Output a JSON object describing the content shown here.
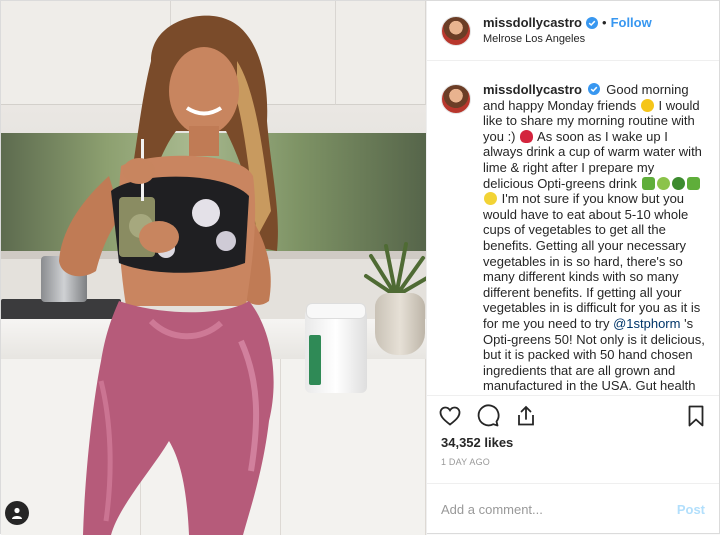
{
  "header": {
    "username": "missdollycastro",
    "separator": "•",
    "follow_label": "Follow",
    "location": "Melrose Los Angeles"
  },
  "caption": {
    "username": "missdollycastro",
    "t1": "Good morning and happy Monday friends",
    "t2": "I would like to share my morning routine with you :)",
    "t3": "As soon as I wake up I always drink a cup of warm water with lime & right after I prepare my delicious Opti-greens drink",
    "t4": "I'm not sure if you know but you would have to eat about 5-10 whole cups of vegetables to get all the benefits. Getting all your necessary vegetables in is so hard, there's so many different kinds with so many different benefits. If getting all your vegetables in is difficult for you as it is for me you need to try",
    "mention": "@1stphorm",
    "t5": "'s Opti-greens 50! Not only is it delicious, but it is packed with 50 hand chosen ingredients that are all grown and manufactured in the USA. Gut health"
  },
  "stats": {
    "likes": "34,352 likes",
    "time": "1 day ago"
  },
  "comment_box": {
    "placeholder": "Add a comment...",
    "post_label": "Post"
  },
  "icons": [
    "verified-icon",
    "heart-icon",
    "comment-icon",
    "share-icon",
    "bookmark-icon",
    "user-tag-icon"
  ],
  "colors": {
    "link": "#3897f0",
    "verified": "#3897f0",
    "post_disabled": "#b2dffc",
    "mention": "#003569"
  }
}
